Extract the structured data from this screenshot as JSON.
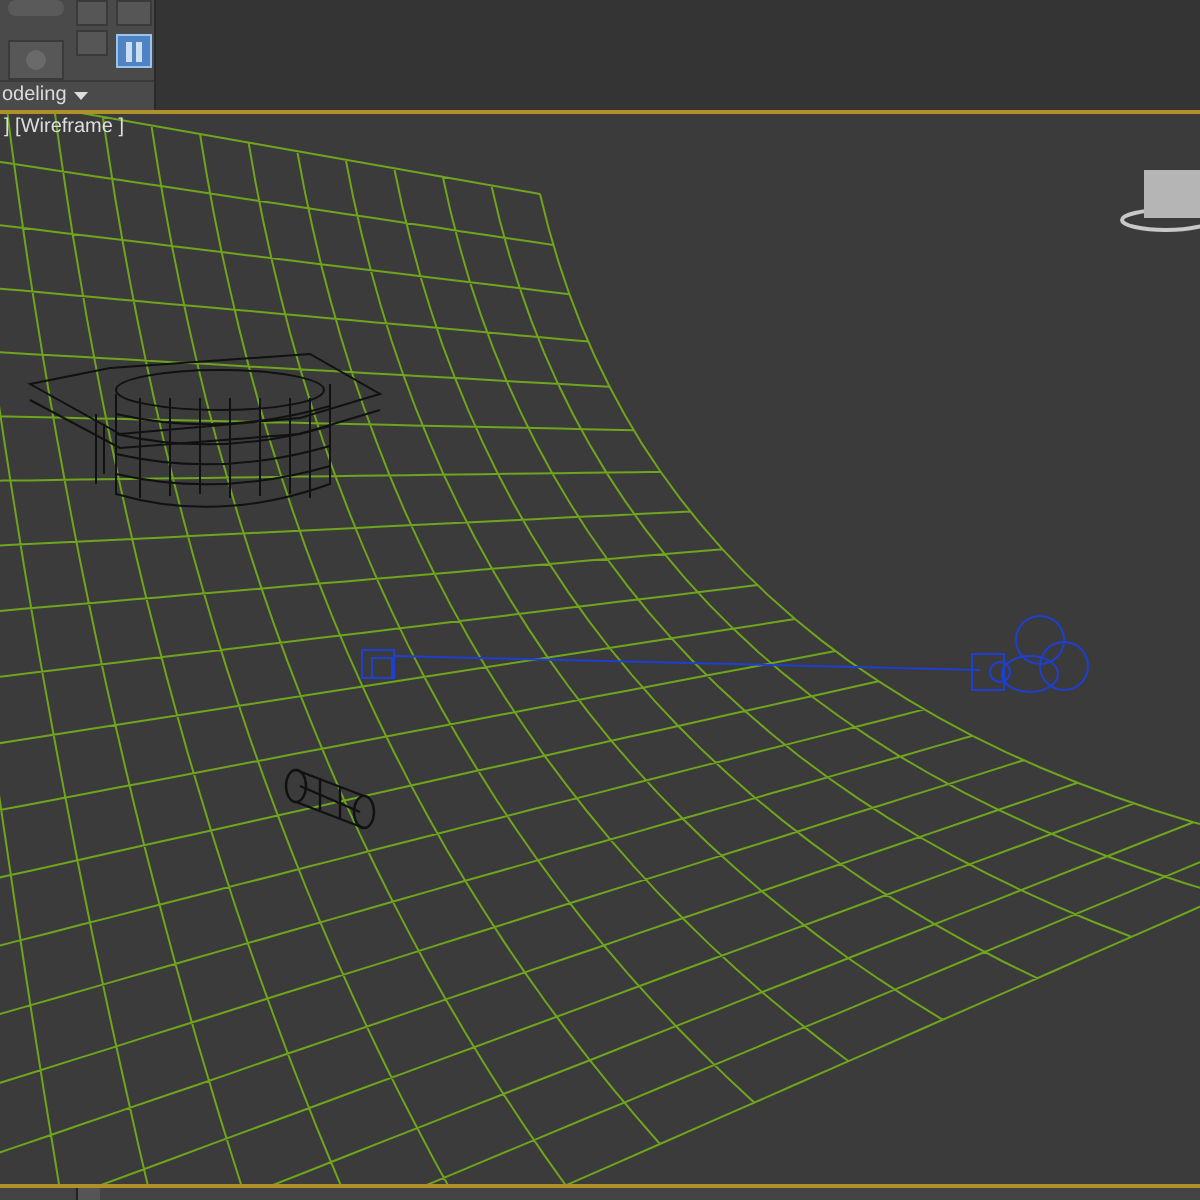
{
  "ribbon": {
    "tool_buttons": [
      {
        "selected": false
      },
      {
        "selected": false
      },
      {
        "selected": false
      },
      {
        "selected": false
      },
      {
        "selected": true
      }
    ],
    "panel_label": "odeling"
  },
  "viewport": {
    "label": "] [Wireframe ]"
  }
}
